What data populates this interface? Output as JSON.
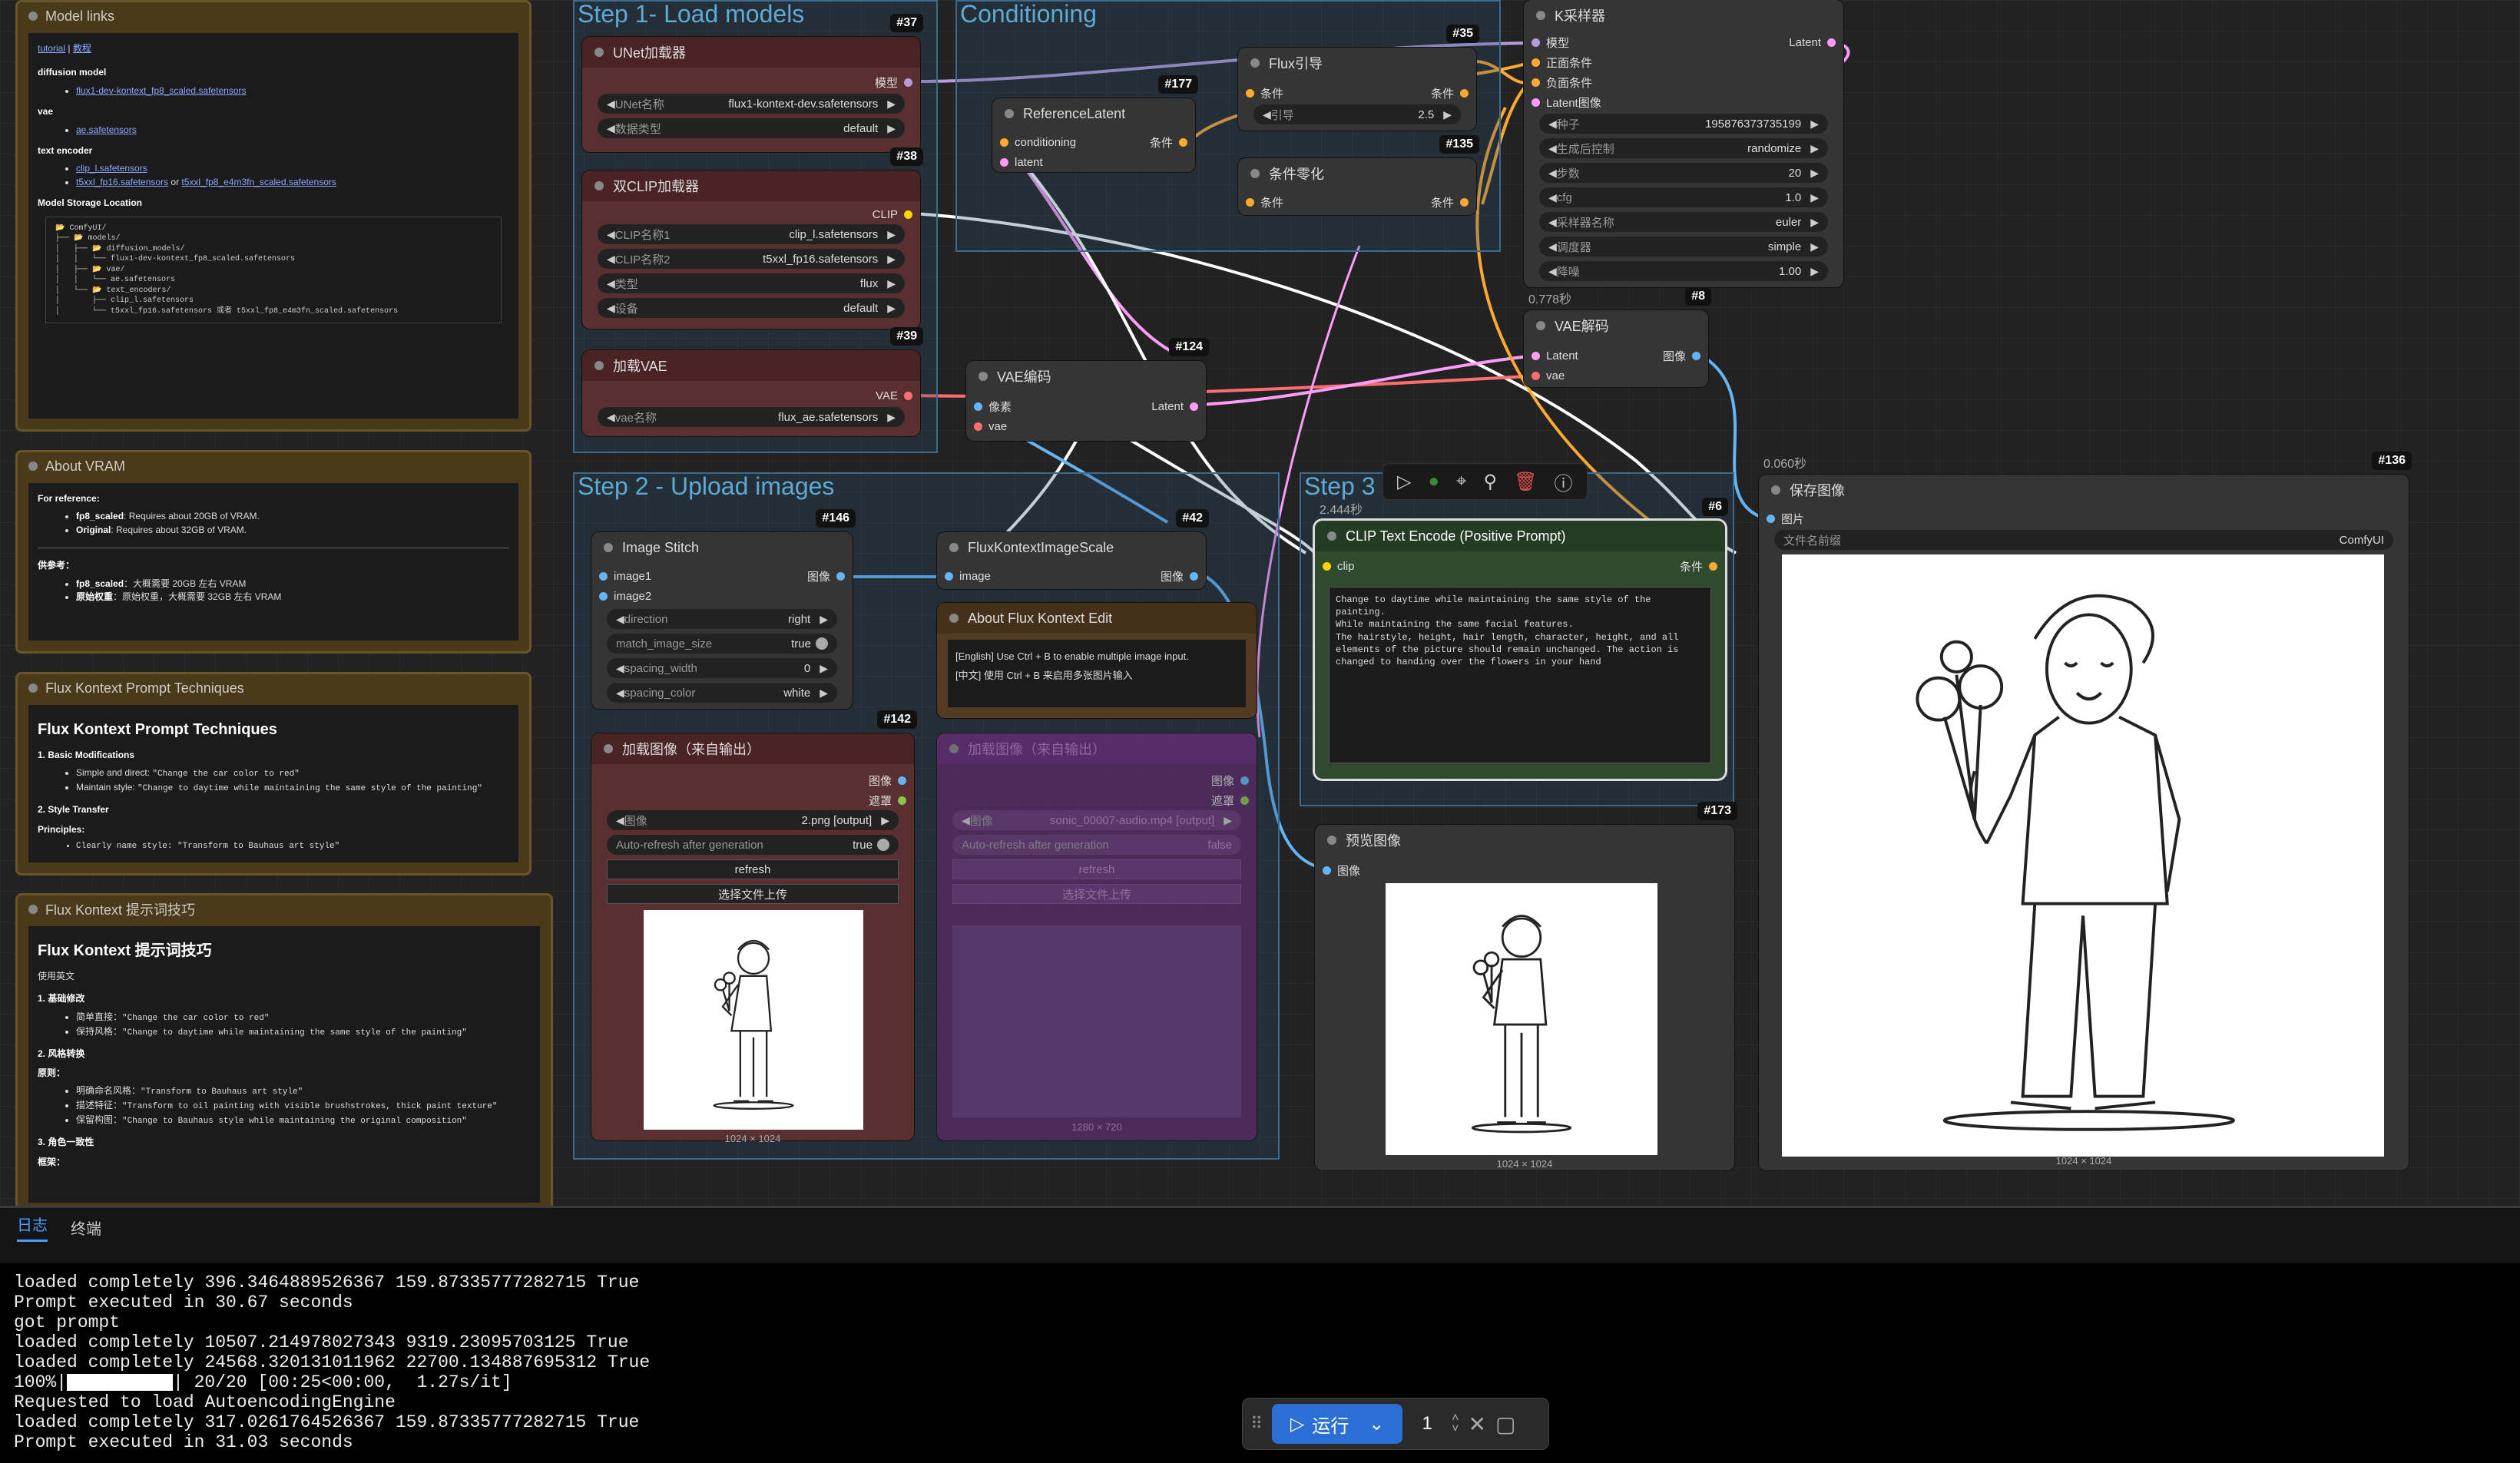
{
  "groups": {
    "step1": "Step 1- Load models",
    "conditioning": "Conditioning",
    "step2": "Step 2 - Upload images",
    "step3": "Step 3"
  },
  "notes": {
    "model_links": {
      "title": "Model links",
      "tutorial": "tutorial",
      "sep": " | ",
      "tutorial_cn": "教程",
      "diffusion_model": "diffusion model",
      "diffusion_file": "flux1-dev-kontext_fp8_scaled.safetensors",
      "vae": "vae",
      "vae_file": "ae.safetensors",
      "text_encoder": "text encoder",
      "te1": "clip_l.safetensors",
      "te2": "t5xxl_fp16.safetensors",
      "or": " or ",
      "te3": "t5xxl_fp8_e4m3fn_scaled.safetensors",
      "storage": "Model Storage Location",
      "tree": "📂 ComfyUI/\n├── 📂 models/\n│   ├── 📂 diffusion_models/\n│   │   └── flux1-dev-kontext_fp8_scaled.safetensors\n│   ├── 📂 vae/\n│   │   └── ae.safetensors\n│   └── 📂 text_encoders/\n│       ├── clip_l.safetensors\n│       └── t5xxl_fp16.safetensors 或者 t5xxl_fp8_e4m3fn_scaled.safetensors"
    },
    "vram": {
      "title": "About VRAM",
      "ref": "For reference:",
      "b1k": "fp8_scaled",
      "b1": ": Requires about 20GB of VRAM.",
      "b2k": "Original",
      "b2": ": Requires about 32GB of VRAM.",
      "ref_cn": "供参考：",
      "c1k": "fp8_scaled",
      "c1": "：大概需要 20GB 左右 VRAM",
      "c2k": "原始权重",
      "c2": "：原始权重，大概需要 32GB 左右 VRAM"
    },
    "prompt_en": {
      "title": "Flux Kontext Prompt Techniques",
      "h": "Flux Kontext Prompt Techniques",
      "s1": "1. Basic Modifications",
      "l1k": "Simple and direct:",
      "l1": "\"Change the car color to red\"",
      "l2k": "Maintain style:",
      "l2": "\"Change to daytime while maintaining the same style of the painting\"",
      "s2": "2. Style Transfer",
      "p": "Principles:",
      "l3": "Clearly name style: \"Transform to Bauhaus art style\""
    },
    "prompt_cn": {
      "title": "Flux Kontext 提示词技巧",
      "h": "Flux Kontext 提示词技巧",
      "use": "使用英文",
      "s1": "1. 基础修改",
      "l1k": "简单直接：",
      "l1": "\"Change the car color to red\"",
      "l2k": "保持风格：",
      "l2": "\"Change to daytime while maintaining the same style of the painting\"",
      "s2": "2. 风格转换",
      "p": "原则：",
      "l3k": "明确命名风格：",
      "l3": "\"Transform to Bauhaus art style\"",
      "l4k": "描述特征：",
      "l4": "\"Transform to oil painting with visible brushstrokes, thick paint texture\"",
      "l5k": "保留构图：",
      "l5": "\"Change to Bauhaus style while maintaining the original composition\"",
      "s3": "3. 角色一致性",
      "p2": "框架："
    }
  },
  "nodes": {
    "unet": {
      "id": "#37",
      "title": "UNet加载器",
      "out": "模型",
      "w1l": "UNet名称",
      "w1v": "flux1-kontext-dev.safetensors",
      "w2l": "数据类型",
      "w2v": "default"
    },
    "clip": {
      "id": "#38",
      "title": "双CLIP加载器",
      "out": "CLIP",
      "w1l": "CLIP名称1",
      "w1v": "clip_l.safetensors",
      "w2l": "CLIP名称2",
      "w2v": "t5xxl_fp16.safetensors",
      "w3l": "类型",
      "w3v": "flux",
      "w4l": "设备",
      "w4v": "default"
    },
    "vae": {
      "id": "#39",
      "title": "加载VAE",
      "out": "VAE",
      "w1l": "vae名称",
      "w1v": "flux_ae.safetensors"
    },
    "reflatent": {
      "id": "#177",
      "title": "ReferenceLatent",
      "in1": "conditioning",
      "in2": "latent",
      "out": "条件"
    },
    "fluxguide": {
      "id": "#35",
      "title": "Flux引导",
      "in1": "条件",
      "out": "条件",
      "w1l": "引导",
      "w1v": "2.5"
    },
    "condzero": {
      "id": "#135",
      "title": "条件零化",
      "in1": "条件",
      "out": "条件"
    },
    "ksampler": {
      "title": "K采样器",
      "in1": "模型",
      "in2": "正面条件",
      "in3": "负面条件",
      "in4": "Latent图像",
      "out": "Latent",
      "widgets": [
        {
          "l": "种子",
          "v": "195876373735199"
        },
        {
          "l": "生成后控制",
          "v": "randomize"
        },
        {
          "l": "步数",
          "v": "20"
        },
        {
          "l": "cfg",
          "v": "1.0"
        },
        {
          "l": "采样器名称",
          "v": "euler"
        },
        {
          "l": "调度器",
          "v": "simple"
        },
        {
          "l": "降噪",
          "v": "1.00"
        }
      ]
    },
    "vaedecode": {
      "id": "#8",
      "time": "0.778秒",
      "title": "VAE解码",
      "in1": "Latent",
      "in2": "vae",
      "out": "图像"
    },
    "vaeencode": {
      "id": "#124",
      "title": "VAE编码",
      "in1": "像素",
      "in2": "vae",
      "out": "Latent"
    },
    "stitch": {
      "id": "#146",
      "title": "Image Stitch",
      "in1": "image1",
      "in2": "image2",
      "out": "图像",
      "widgets": [
        {
          "l": "direction",
          "v": "right"
        },
        {
          "l": "match_image_size",
          "v": "true"
        },
        {
          "l": "spacing_width",
          "v": "0"
        },
        {
          "l": "spacing_color",
          "v": "white"
        }
      ]
    },
    "scale": {
      "id": "#42",
      "title": "FluxKontextImageScale",
      "in1": "image",
      "out": "图像"
    },
    "about": {
      "title": "About Flux Kontext Edit",
      "l1": "[English] Use Ctrl + B to enable multiple image input.",
      "l2": "[中文] 使用 Ctrl + B 来启用多张图片输入"
    },
    "loadimg": {
      "id": "#142",
      "title": "加载图像（来自输出）",
      "out1": "图像",
      "out2": "遮罩",
      "w1l": "图像",
      "w1v": "2.png [output]",
      "w2l": "Auto-refresh after generation",
      "w2v": "true",
      "b1": "refresh",
      "b2": "选择文件上传",
      "cap": "1024 × 1024"
    },
    "loadimg2": {
      "title": "加载图像（来自输出）",
      "out1": "图像",
      "out2": "遮罩",
      "w1l": "图像",
      "w1v": "sonic_00007-audio.mp4 [output]",
      "w2l": "Auto-refresh after generation",
      "w2v": "false",
      "b1": "refresh",
      "b2": "选择文件上传",
      "cap": "1280 × 720"
    },
    "cliptext": {
      "id": "#6",
      "time": "2.444秒",
      "title": "CLIP Text Encode (Positive Prompt)",
      "in1": "clip",
      "out": "条件",
      "text": "Change to daytime while maintaining the same style of the painting.\nWhile maintaining the same facial features.\nThe hairstyle, height, hair length, character, height, and all elements of the picture should remain unchanged. The action is changed to handing over the flowers in your hand"
    },
    "preview": {
      "id": "#173",
      "title": "预览图像",
      "in1": "图像",
      "cap": "1024 × 1024"
    },
    "save": {
      "id": "#136",
      "time": "0.060秒",
      "title": "保存图像",
      "in1": "图片",
      "w1l": "文件名前缀",
      "w1v": "ComfyUI",
      "cap": "1024 × 1024"
    }
  },
  "bottom": {
    "tab_log": "日志",
    "tab_terminal": "终端",
    "log": [
      "loaded completely 396.3464889526367 159.87335777282715 True",
      "Prompt executed in 30.67 seconds",
      "got prompt",
      "loaded completely 10507.214978027343 9319.23095703125 True",
      "loaded completely 24568.320131011962 22700.134887695312 True",
      "100%|",
      "| 20/20 [00:25<00:00,  1.27s/it]",
      "Requested to load AutoencodingEngine",
      "loaded completely 317.0261764526367 159.87335777282715 True",
      "Prompt executed in 31.03 seconds"
    ],
    "run_label": "运行",
    "queue_count": "1"
  },
  "colors": {
    "model": "#b39ddb",
    "clip": "#ffd500",
    "vae": "#ff6e6e",
    "conditioning": "#ffa931",
    "latent": "#ff9cf9",
    "image": "#64b5f6"
  }
}
